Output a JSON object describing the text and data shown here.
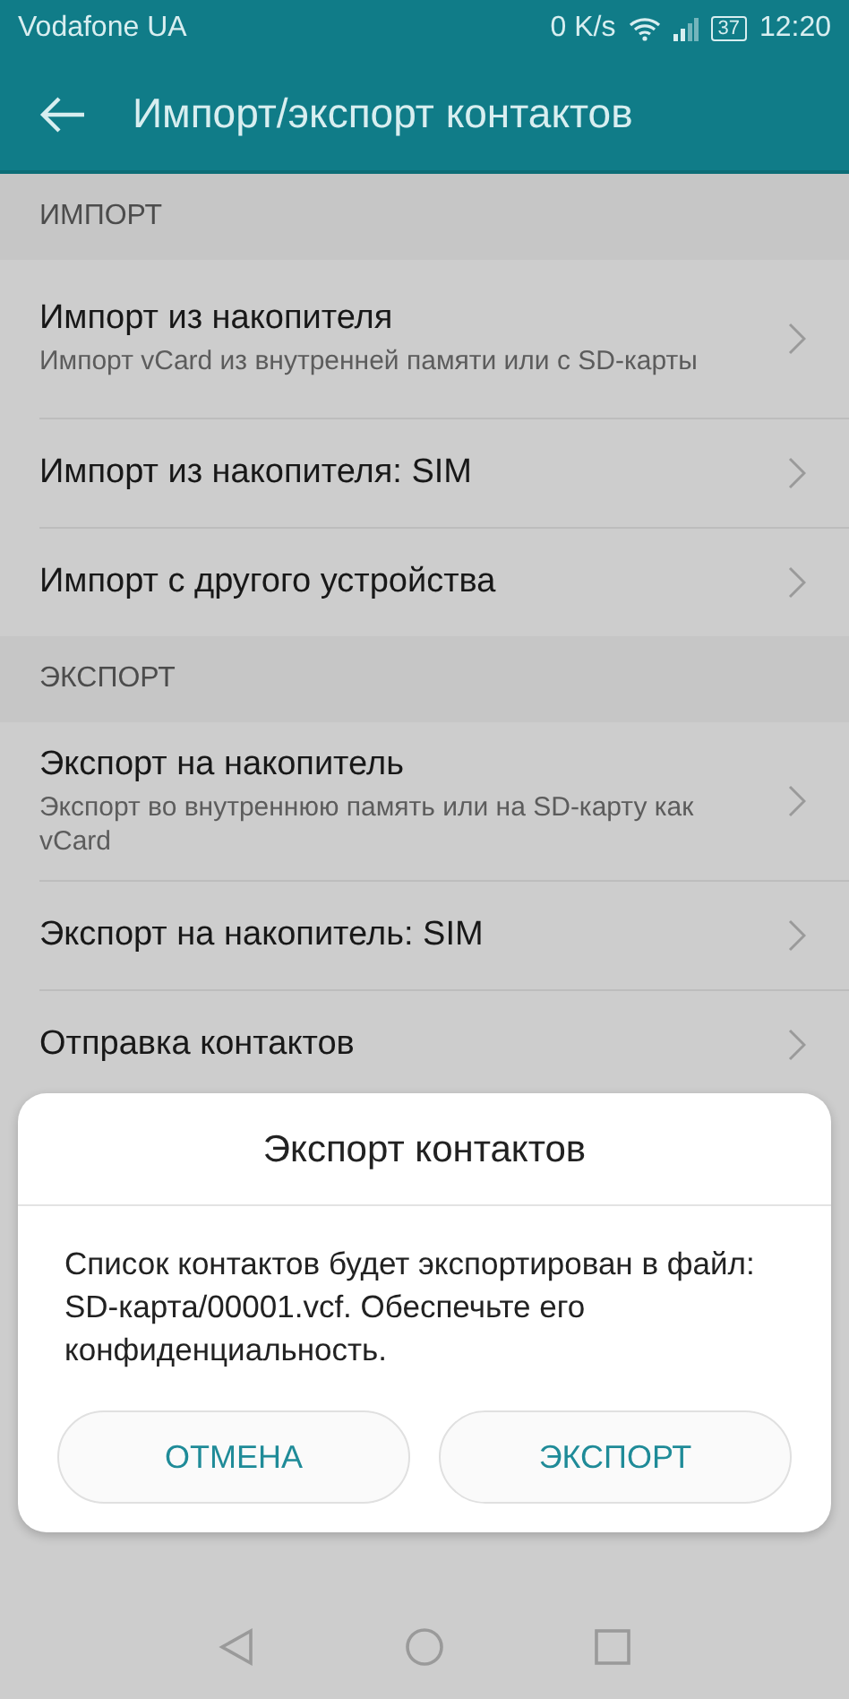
{
  "status_bar": {
    "carrier": "Vodafone UA",
    "speed": "0 K/s",
    "battery": "37",
    "time": "12:20"
  },
  "app_bar": {
    "title": "Импорт/экспорт контактов"
  },
  "sections": [
    {
      "title": "ИМПОРТ",
      "items": [
        {
          "title": "Импорт из накопителя",
          "subtitle": "Импорт vCard из внутренней памяти или с SD-карты"
        },
        {
          "title": "Импорт из накопителя: SIM"
        },
        {
          "title": "Импорт с другого устройства"
        }
      ]
    },
    {
      "title": "ЭКСПОРТ",
      "items": [
        {
          "title": "Экспорт на накопитель",
          "subtitle": "Экспорт во внутреннюю память или на SD-карту как vCard"
        },
        {
          "title": "Экспорт на накопитель: SIM"
        },
        {
          "title": "Отправка контактов"
        }
      ]
    }
  ],
  "dialog": {
    "title": "Экспорт контактов",
    "message": "Список контактов будет экспортирован в файл: SD-карта/00001.vcf. Обеспечьте его конфиденциальность.",
    "buttons": [
      "ОТМЕНА",
      "ЭКСПОРТ"
    ]
  }
}
